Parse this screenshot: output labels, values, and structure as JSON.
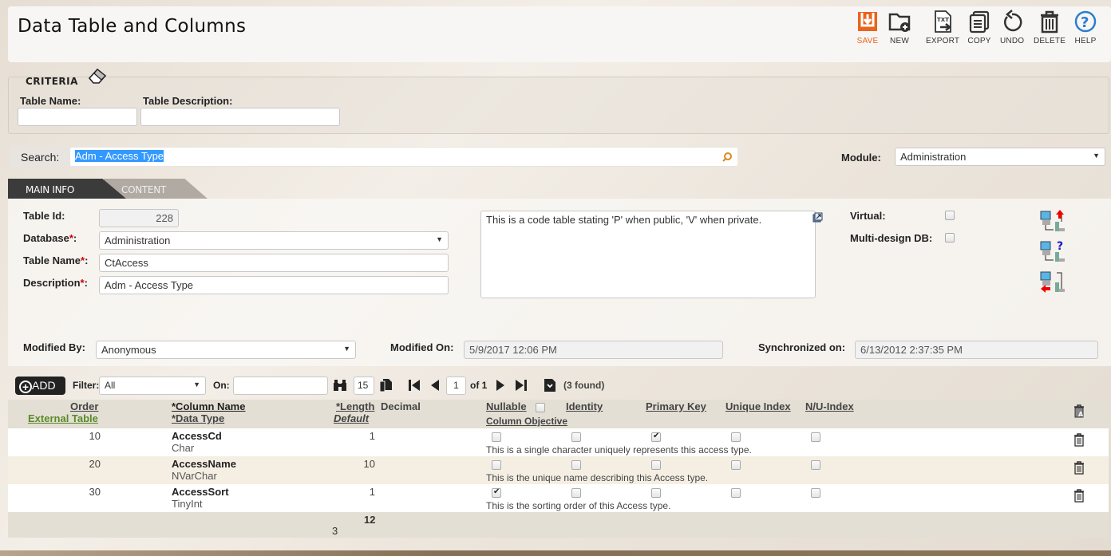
{
  "header": {
    "title": "Data Table and Columns"
  },
  "toolbar": [
    {
      "id": "save",
      "label": "SAVE",
      "icon": "save-icon",
      "color": "#e8641e"
    },
    {
      "id": "new",
      "label": "NEW",
      "icon": "new-folder-icon"
    },
    {
      "id": "export",
      "label": "EXPORT",
      "icon": "export-txt-icon"
    },
    {
      "id": "copy",
      "label": "COPY",
      "icon": "copy-icon"
    },
    {
      "id": "undo",
      "label": "UNDO",
      "icon": "undo-icon"
    },
    {
      "id": "delete",
      "label": "DELETE",
      "icon": "trash-icon"
    },
    {
      "id": "help",
      "label": "HELP",
      "icon": "help-icon",
      "color": "#2a7fd0"
    }
  ],
  "criteria": {
    "title": "CRITERIA",
    "table_name_label": "Table Name:",
    "table_name_value": "",
    "table_desc_label": "Table Description:",
    "table_desc_value": ""
  },
  "search": {
    "label": "Search:",
    "value": "Adm - Access Type"
  },
  "module": {
    "label": "Module:",
    "value": "Administration"
  },
  "tabs": [
    {
      "label": "MAIN INFO",
      "active": true
    },
    {
      "label": "CONTENT",
      "active": false
    }
  ],
  "main": {
    "table_id_label": "Table Id:",
    "table_id": "228",
    "database_label": "Database",
    "database": "Administration",
    "table_name_label": "Table Name",
    "table_name": "CtAccess",
    "description_label": "Description",
    "description": "Adm - Access Type",
    "required_mark": "*",
    "colon": ":",
    "notes": "This is a code table stating 'P' when public, 'V' when private.",
    "virtual_label": "Virtual:",
    "virtual": false,
    "multidesign_label": "Multi-design DB:",
    "multidesign": false,
    "modified_by_label": "Modified By:",
    "modified_by": "Anonymous",
    "modified_on_label": "Modified On:",
    "modified_on": "5/9/2017 12:06 PM",
    "synced_label": "Synchronized on:",
    "synced_on": "6/13/2012 2:37:35 PM"
  },
  "grid_toolbar": {
    "add_label": "ADD",
    "filter_label": "Filter:",
    "filter_value": "All",
    "on_label": "On:",
    "on_value": "",
    "page_size": "15",
    "page": "1",
    "of_label": "of 1",
    "found": "(3 found)"
  },
  "grid": {
    "headers": {
      "order": "Order",
      "external_table": "External Table",
      "column_name": "*Column Name",
      "data_type": "*Data Type",
      "length": "*Length",
      "decimal": "Decimal",
      "default": "Default",
      "nullable": "Nullable",
      "column_objective": "Column Objective",
      "identity": "Identity",
      "primary_key": "Primary Key",
      "unique_index": "Unique Index",
      "nu_index": "N/U-Index"
    },
    "rows": [
      {
        "order": "10",
        "name": "AccessCd",
        "type": "Char",
        "length": "1",
        "nullable": false,
        "identity": false,
        "pk": true,
        "unique": false,
        "nu": false,
        "objective": "This is a single character uniquely represents this access type."
      },
      {
        "order": "20",
        "name": "AccessName",
        "type": "NVarChar",
        "length": "10",
        "nullable": false,
        "identity": false,
        "pk": false,
        "unique": false,
        "nu": false,
        "objective": "This is the unique name describing this Access type."
      },
      {
        "order": "30",
        "name": "AccessSort",
        "type": "TinyInt",
        "length": "1",
        "nullable": true,
        "identity": false,
        "pk": false,
        "unique": false,
        "nu": false,
        "objective": "This is the sorting order of this Access type."
      }
    ],
    "footer": {
      "length_total": "12",
      "count": "3"
    }
  }
}
